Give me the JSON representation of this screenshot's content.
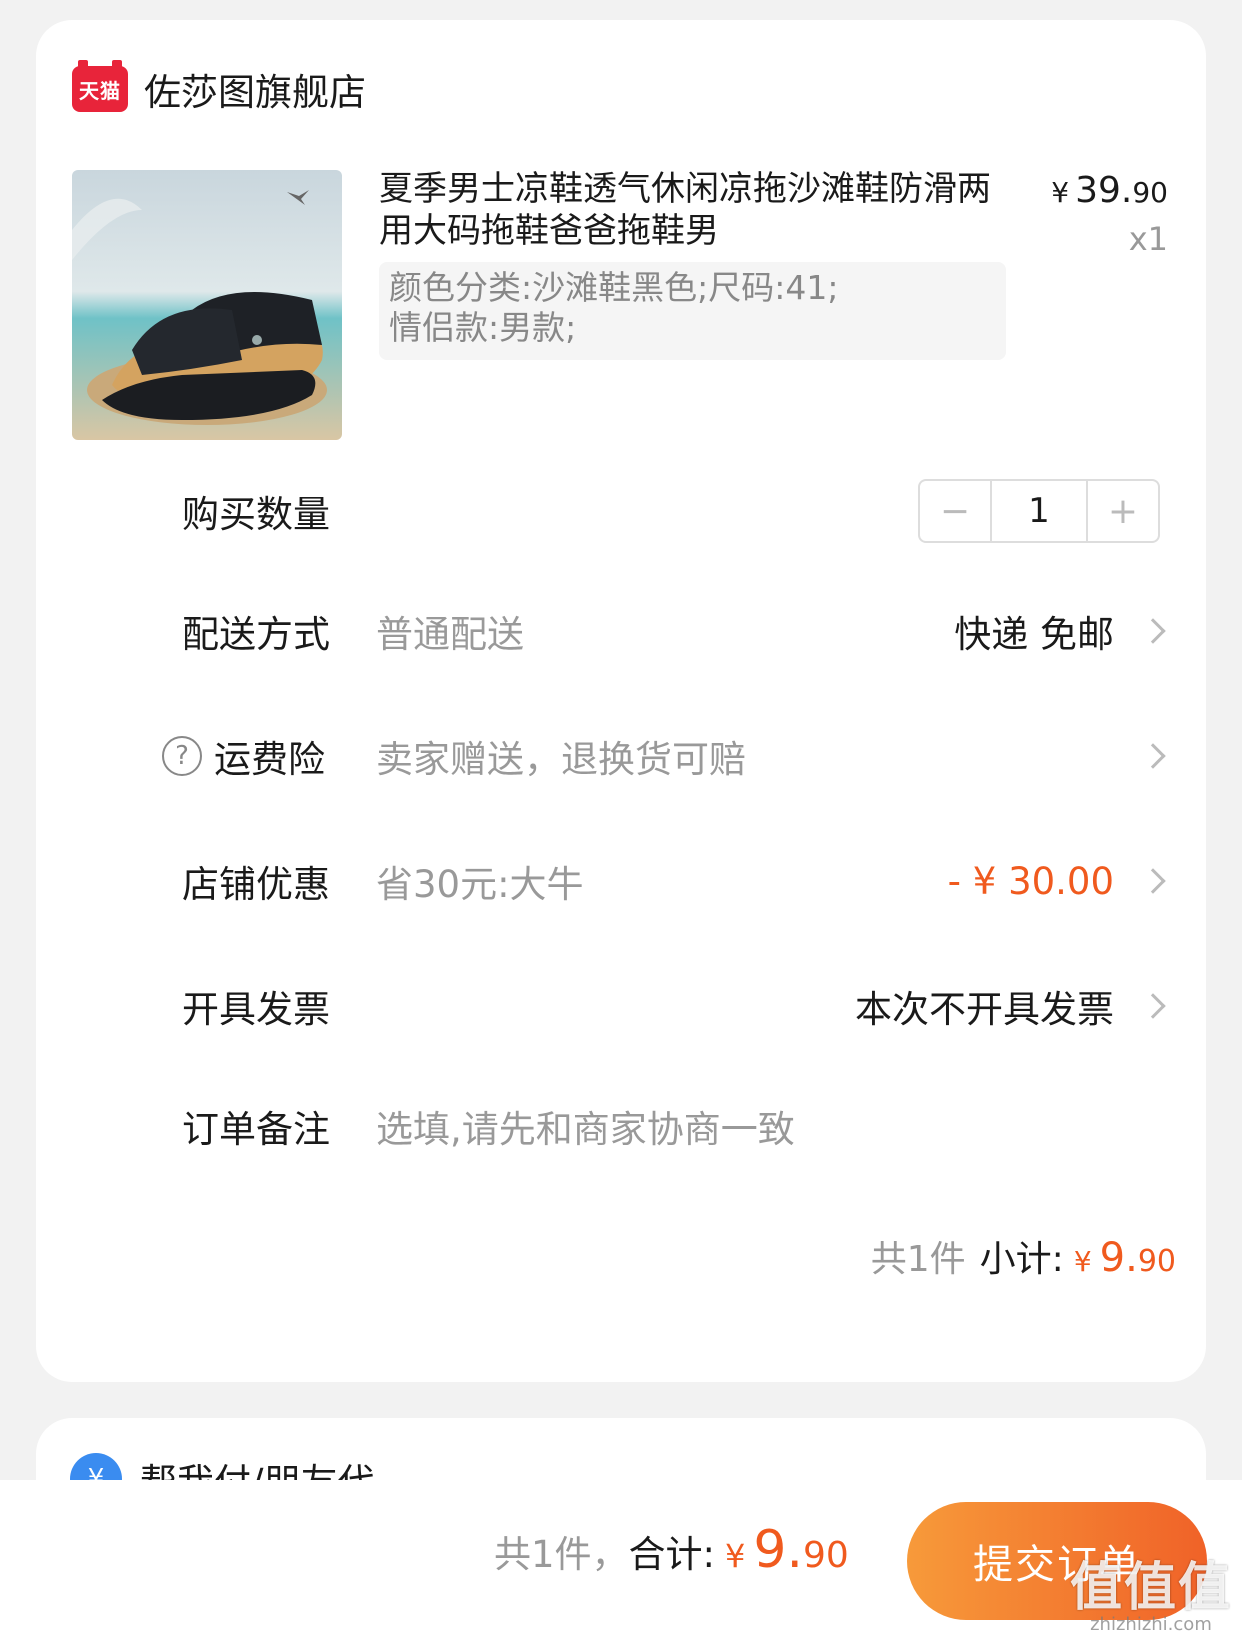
{
  "shop": {
    "badge": "天猫",
    "name": "佐莎图旗舰店"
  },
  "product": {
    "title": "夏季男士凉鞋透气休闲凉拖沙滩鞋防滑两用大码拖鞋爸爸拖鞋男",
    "price_symbol": "¥",
    "price_int": "39.",
    "price_dec": "90",
    "quantity": "x1",
    "sku_line1": "颜色分类:沙滩鞋黑色;尺码:41;",
    "sku_line2": "情侣款:男款;"
  },
  "rows": {
    "qty_label": "购买数量",
    "qty_value": "1",
    "qty_minus": "−",
    "qty_plus": "+",
    "shipping_label": "配送方式",
    "shipping_value": "普通配送",
    "shipping_right": "快递 免邮",
    "insurance_help": "?",
    "insurance_label": "运费险",
    "insurance_value": "卖家赠送，退换货可赔",
    "discount_label": "店铺优惠",
    "discount_value": "省30元:大牛",
    "discount_right": "- ¥ 30.00",
    "invoice_label": "开具发票",
    "invoice_right": "本次不开具发票",
    "note_label": "订单备注",
    "note_placeholder": "选填,请先和商家协商一致"
  },
  "subtotal": {
    "count": "共1件",
    "label": "小计:",
    "yen": "¥",
    "amount": "9.",
    "decimal": "90"
  },
  "pay_friend": {
    "icon": "¥",
    "label": "帮我付/朋友代"
  },
  "footer": {
    "count": "共1件，",
    "label": "合计:",
    "yen": "¥",
    "amount": "9.",
    "decimal": "90",
    "submit": "提交订单"
  },
  "watermark": {
    "big": "值值值",
    "small": "zhizhizhi.com"
  },
  "colors": {
    "accent": "#f05a1e",
    "tmall": "#e8243a"
  }
}
